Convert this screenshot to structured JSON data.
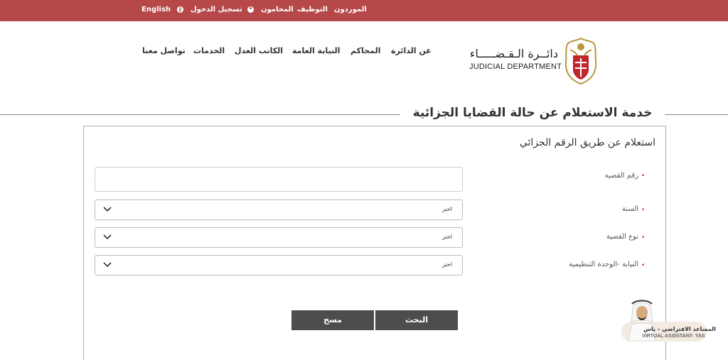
{
  "topbar": {
    "english": "English",
    "login": "تسجيل الدخول",
    "lawyers": "المحامون",
    "careers": "التوظيف",
    "suppliers": "الموردون"
  },
  "nav": {
    "about": "عن الدائرة",
    "courts": "المحاكم",
    "prosecution": "النيابة العامة",
    "notary": "الكاتب العدل",
    "services": "الخدمات",
    "contact": "تواصل معنا"
  },
  "logo": {
    "arabic": "دائــرة الـقـضـــــاء",
    "english": "JUDICIAL DEPARTMENT"
  },
  "page": {
    "title": "خدمة الاستعلام عن حالة القضايا الجزائية",
    "subtitle": "استعلام عن طريق الرقم الجزائي"
  },
  "form": {
    "case_number_label": "رقم القضية",
    "case_number_value": "",
    "year_label": "السنة",
    "year_value": "اختر",
    "case_type_label": "نوع القضية",
    "case_type_value": "اختر",
    "prosecution_label": "النيابة -الوحدة التنظيمية",
    "prosecution_value": "اختر",
    "required_mark": "•"
  },
  "buttons": {
    "search": "البحث",
    "clear": "مسح"
  },
  "assistant": {
    "arabic": "المساعد الافتراضي - ياس",
    "english": "VIRTUAL ASSISTANT- YAS"
  },
  "colors": {
    "topbar": "#b7484a",
    "button": "#4d4d4d",
    "required": "#c0392b"
  }
}
